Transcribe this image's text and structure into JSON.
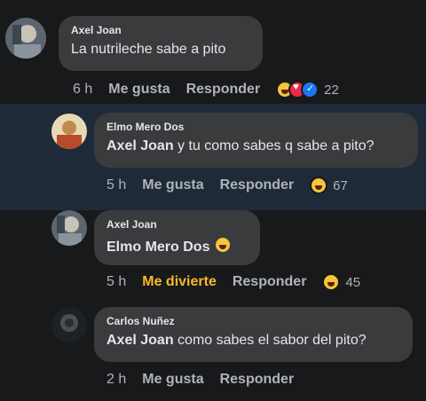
{
  "comments": [
    {
      "author": "Axel Joan",
      "text": "La nutrileche sabe a pito",
      "time": "6 h",
      "action1": "Me gusta",
      "reply": "Responder",
      "reaction_count": "22",
      "reactions": [
        "haha-icon",
        "love-icon",
        "like-icon"
      ]
    },
    {
      "author": "Elmo Mero Dos",
      "mention": "Axel Joan",
      "text": " y tu como sabes q sabe a pito?",
      "time": "5 h",
      "action1": "Me gusta",
      "reply": "Responder",
      "reaction_count": "67",
      "reactions": [
        "haha-icon"
      ]
    },
    {
      "author": "Axel Joan",
      "mention": "Elmo Mero Dos",
      "time": "5 h",
      "action1": "Me divierte",
      "reply": "Responder",
      "reaction_count": "45",
      "reactions": [
        "haha-icon"
      ]
    },
    {
      "author": "Carlos Nuñez",
      "mention": "Axel Joan",
      "text": " como sabes el sabor del pito?",
      "time": "2 h",
      "action1": "Me gusta",
      "reply": "Responder"
    }
  ],
  "colors": {
    "background": "#18191a",
    "highlight": "#1f2a38",
    "bubble": "#3a3b3c",
    "haha_text": "#f7b928"
  }
}
